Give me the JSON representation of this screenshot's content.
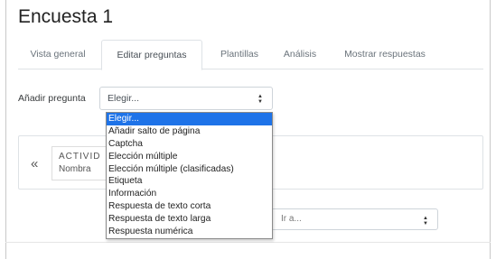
{
  "page": {
    "title": "Encuesta 1"
  },
  "tabs": [
    {
      "label": "Vista general"
    },
    {
      "label": "Editar preguntas"
    },
    {
      "label": "Plantillas"
    },
    {
      "label": "Análisis"
    },
    {
      "label": "Mostrar respuestas"
    }
  ],
  "add_question": {
    "label": "Añadir pregunta",
    "selected": "Elegir...",
    "options": [
      "Elegir...",
      "Añadir salto de página",
      "Captcha",
      "Elección múltiple",
      "Elección múltiple (clasificadas)",
      "Etiqueta",
      "Información",
      "Respuesta de texto corta",
      "Respuesta de texto larga",
      "Respuesta numérica"
    ]
  },
  "activity_nav": {
    "prev_icon": "«",
    "title": "ACTIVID",
    "subtitle": "Nombra"
  },
  "jump_select": {
    "value": "Ir a..."
  },
  "colors": {
    "selected_option": "#1e73e8",
    "active_tab_border": "#dee2e6"
  }
}
